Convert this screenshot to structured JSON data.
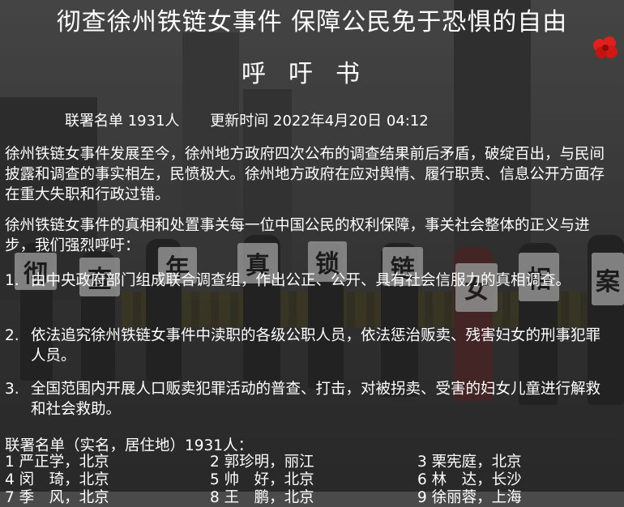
{
  "title": "彻查徐州铁链女事件 保障公民免于恐惧的自由",
  "subtitle": "呼吁书",
  "meta": {
    "signatories_label": "联署名单 1931人",
    "updated_label": "更新时间 2022年4月20日 04:12"
  },
  "paragraphs": [
    "徐州铁链女事件发展至今，徐州地方政府四次公布的调查结果前后矛盾，破绽百出，与民间披露和调查的事实相左，民愤极大。徐州地方政府在应对舆情、履行职责、信息公开方面存在重大失职和行政过错。",
    "徐州铁链女事件的真相和处置事关每一位中国公民的权利保障，事关社会整体的正义与进步，我们强烈呼吁："
  ],
  "demands": [
    {
      "num": "1.",
      "text": "由中央政府部门组成联合调查组，作出公正、公开、具有社会信服力的真相调查。"
    },
    {
      "num": "2.",
      "text": "依法追究徐州铁链女事件中渎职的各级公职人员，依法惩治贩卖、残害妇女的刑事犯罪人员。"
    },
    {
      "num": "3.",
      "text": "全国范围内开展人口贩卖犯罪活动的普查、打击，对被拐卖、受害的妇女儿童进行解救和社会救助。"
    }
  ],
  "signatures_heading": "联署名单（实名，居住地）1931人：",
  "signatures": [
    [
      "1 严正学，北京",
      "2 郭珍明，丽江",
      "3 栗宪庭，北京"
    ],
    [
      "4 闵　琦，北京",
      "5 帅　好，北京",
      "6 林　达，长沙"
    ],
    [
      "7 季　风，北京",
      "8 王　鹏，北京",
      "9 徐丽蓉，上海"
    ]
  ],
  "background_signs": [
    "彻",
    "查",
    "年",
    "真",
    "锁",
    "链",
    "女",
    "相",
    "案"
  ],
  "colors": {
    "text": "#ffffff",
    "sign": "#cfcfcf",
    "logo": "#e0201c"
  },
  "icons": {
    "logo": "red-flower-logo-icon"
  }
}
